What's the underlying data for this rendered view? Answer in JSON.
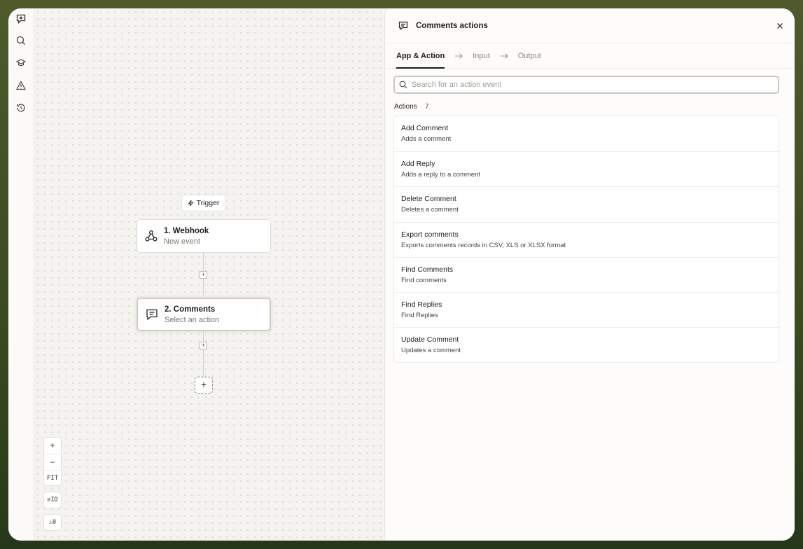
{
  "rail": {
    "items": [
      {
        "name": "comment-app-icon"
      },
      {
        "name": "search-icon"
      },
      {
        "name": "graduation-cap-icon"
      },
      {
        "name": "warning-icon"
      },
      {
        "name": "history-icon"
      }
    ]
  },
  "canvas": {
    "trigger_label": "Trigger",
    "steps": [
      {
        "title": "1. Webhook",
        "subtitle": "New event",
        "icon": "webhook-icon"
      },
      {
        "title": "2. Comments",
        "subtitle": "Select an action",
        "icon": "comment-icon"
      }
    ],
    "zoom": {
      "in": "+",
      "out": "−",
      "fit": "FIT"
    },
    "id_toggle": "ID",
    "warnings": "0"
  },
  "panel": {
    "title": "Comments actions",
    "tabs": [
      "App & Action",
      "Input",
      "Output"
    ],
    "search_placeholder": "Search for an action event",
    "section_label": "Actions",
    "count": "7",
    "actions": [
      {
        "title": "Add Comment",
        "desc": "Adds a comment"
      },
      {
        "title": "Add Reply",
        "desc": "Adds a reply to a comment"
      },
      {
        "title": "Delete Comment",
        "desc": "Deletes a comment"
      },
      {
        "title": "Export comments",
        "desc": "Exports comments records in CSV, XLS or XLSX format"
      },
      {
        "title": "Find Comments",
        "desc": "Find comments"
      },
      {
        "title": "Find Replies",
        "desc": "Find Replies"
      },
      {
        "title": "Update Comment",
        "desc": "Updates a comment"
      }
    ]
  },
  "colors": {
    "background": "#3e4d22",
    "accent": "#1e1e1e"
  }
}
